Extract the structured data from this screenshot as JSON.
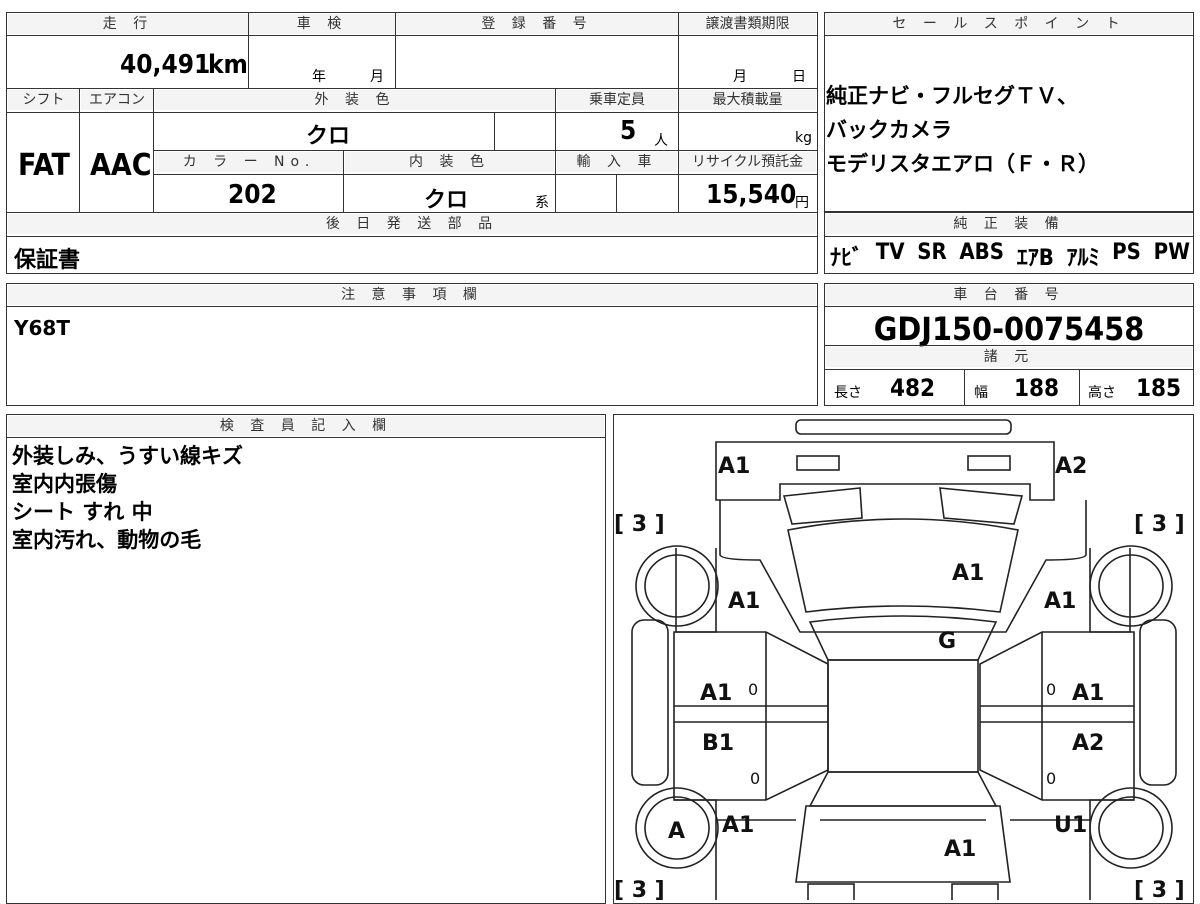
{
  "vehicle": {
    "mileage_label": "走 行",
    "mileage_value": "40,491",
    "mileage_unit": "km",
    "inspection_label": "車 検",
    "inspection_year": "年",
    "inspection_month": "月",
    "registration_label": "登 録 番 号",
    "deadline_label": "譲渡書類期限",
    "deadline_month": "月",
    "deadline_day": "日",
    "shift_label": "シフト",
    "shift_value": "FAT",
    "ac_label": "エアコン",
    "ac_value": "AAC",
    "exterior_label": "外 装 色",
    "exterior_value": "クロ",
    "capacity_label": "乗車定員",
    "capacity_value": "5",
    "capacity_unit": "人",
    "maxload_label": "最大積載量",
    "maxload_unit": "kg",
    "color_no_label": "カ ラ ー No.",
    "color_no_value": "202",
    "interior_label": "内 装 色",
    "interior_value": "クロ",
    "interior_suffix": "系",
    "import_label": "輸 入 車",
    "recycle_label": "リサイクル預託金",
    "recycle_value": "15,540",
    "recycle_unit": "円",
    "later_parts_label": "後 日 発 送 部 品",
    "later_parts_value": "保証書"
  },
  "sales_point": {
    "label": "セ ー ル ス ポ イ ン ト",
    "lines": [
      "純正ナビ・フルセグＴＶ、",
      "バックカメラ",
      "モデリスタエアロ（Ｆ・Ｒ）"
    ]
  },
  "equipment": {
    "label": "純 正 装 備",
    "items": [
      "ﾅﾋﾞ",
      "TV",
      "SR",
      "ABS",
      "ｴｱB",
      "ｱﾙﾐ",
      "PS",
      "PW"
    ]
  },
  "notes": {
    "label": "注 意 事 項 欄",
    "value": "Y68T"
  },
  "chassis": {
    "label": "車 台 番 号",
    "value": "GDJ150-0075458",
    "specs_label": "諸 元",
    "length_label": "長さ",
    "length_value": "482",
    "width_label": "幅",
    "width_value": "188",
    "height_label": "高さ",
    "height_value": "185"
  },
  "inspector": {
    "label": "検 査 員 記 入 欄",
    "lines": [
      "外装しみ、うすい線キズ",
      "室内内張傷",
      "シート すれ 中",
      "室内汚れ、動物の毛"
    ]
  },
  "diagram": {
    "tyre_marks": [
      "[ 3 ]",
      "[ 3 ]",
      "[ 3 ]",
      "[ 3 ]"
    ],
    "labels": [
      "A1",
      "A2",
      "A1",
      "A1",
      "A1",
      "G",
      "A1",
      "A1",
      "B1",
      "A2",
      "A",
      "A1",
      "U1",
      "A1"
    ],
    "zeros": [
      "0",
      "0",
      "0",
      "0"
    ]
  }
}
